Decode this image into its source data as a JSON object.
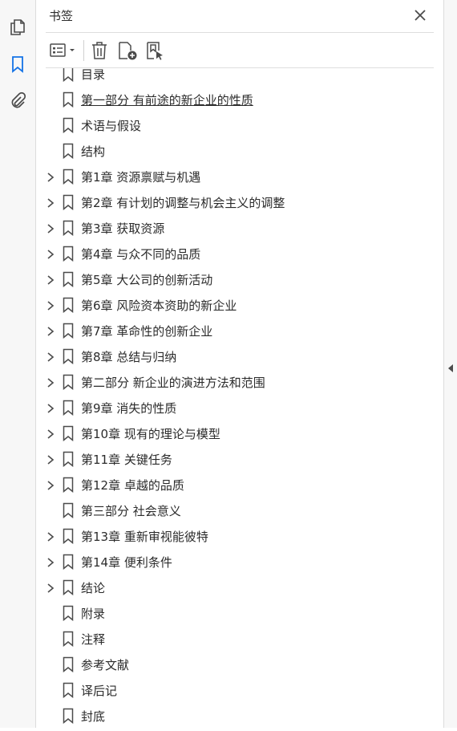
{
  "panel": {
    "title": "书签"
  },
  "bookmarks": [
    {
      "label": "目录",
      "expandable": false
    },
    {
      "label": "第一部分 有前途的新企业的性质",
      "expandable": false,
      "selected": true
    },
    {
      "label": "术语与假设",
      "expandable": false
    },
    {
      "label": "结构",
      "expandable": false
    },
    {
      "label": "第1章 资源禀赋与机遇",
      "expandable": true
    },
    {
      "label": "第2章 有计划的调整与机会主义的调整",
      "expandable": true
    },
    {
      "label": "第3章 获取资源",
      "expandable": true
    },
    {
      "label": "第4章 与众不同的品质",
      "expandable": true
    },
    {
      "label": "第5章 大公司的创新活动",
      "expandable": true
    },
    {
      "label": "第6章 风险资本资助的新企业",
      "expandable": true
    },
    {
      "label": "第7章 革命性的创新企业",
      "expandable": true
    },
    {
      "label": "第8章 总结与归纳",
      "expandable": true
    },
    {
      "label": "第二部分 新企业的演进方法和范围",
      "expandable": true
    },
    {
      "label": "第9章 消失的性质",
      "expandable": true
    },
    {
      "label": "第10章 现有的理论与模型",
      "expandable": true
    },
    {
      "label": "第11章 关键任务",
      "expandable": true
    },
    {
      "label": "第12章 卓越的品质",
      "expandable": true
    },
    {
      "label": "第三部分 社会意义",
      "expandable": false
    },
    {
      "label": "第13章 重新审视能彼特",
      "expandable": true
    },
    {
      "label": "第14章 便利条件",
      "expandable": true
    },
    {
      "label": "结论",
      "expandable": true
    },
    {
      "label": "附录",
      "expandable": false
    },
    {
      "label": "注释",
      "expandable": false
    },
    {
      "label": "参考文献",
      "expandable": false
    },
    {
      "label": "译后记",
      "expandable": false
    },
    {
      "label": "封底",
      "expandable": false
    }
  ],
  "icons": {
    "rail": [
      "pages-icon",
      "bookmark-icon",
      "attachment-icon"
    ],
    "toolbar": [
      "options-menu-icon",
      "delete-icon",
      "new-bookmark-icon",
      "bookmark-from-selection-icon"
    ]
  },
  "colors": {
    "accent": "#1473e6",
    "icon": "#4b4b4b",
    "text": "#2b2b2b"
  }
}
